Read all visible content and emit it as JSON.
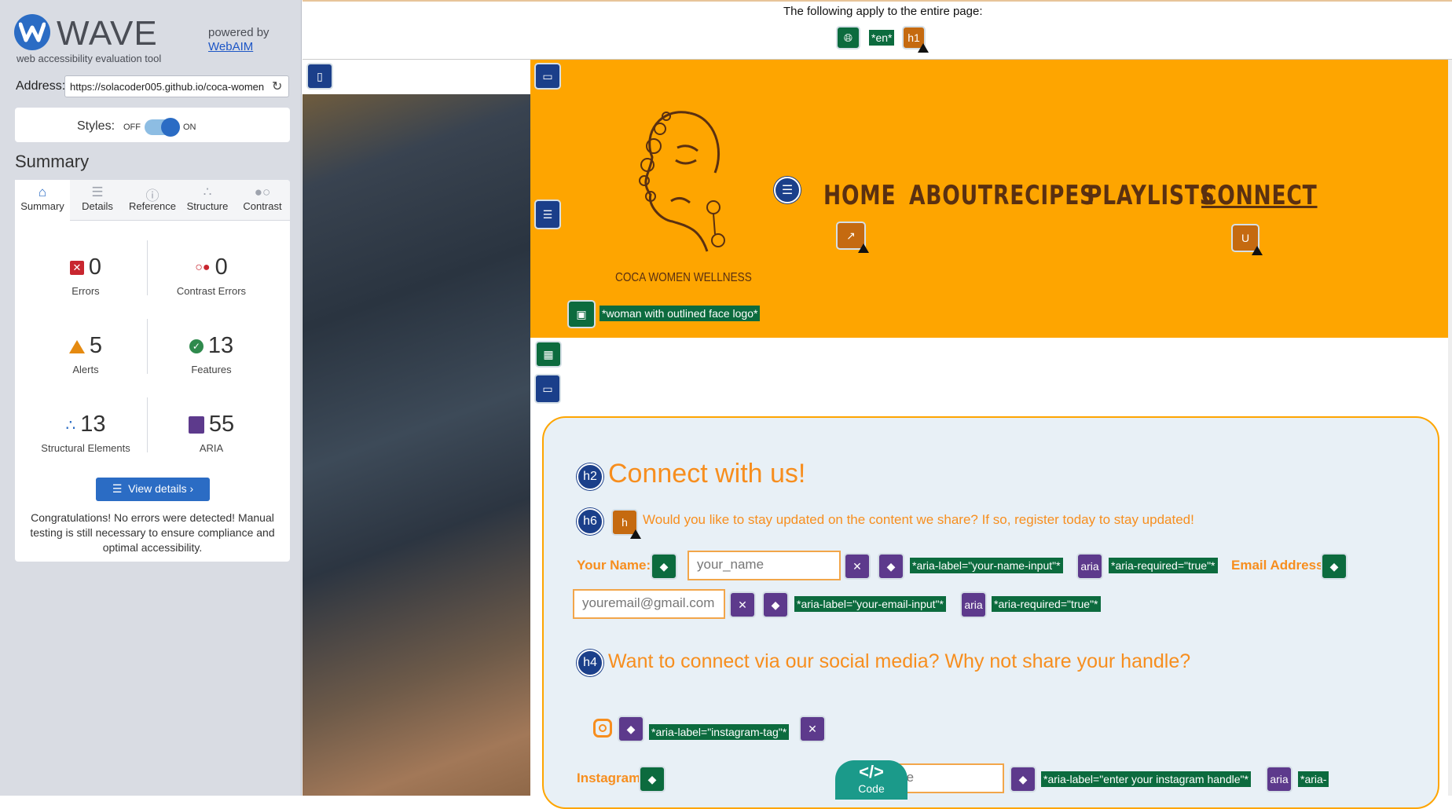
{
  "wave": {
    "logo_text": "WAVE",
    "logo_sub": "web accessibility evaluation tool",
    "powered_by": "powered by",
    "webaim": "WebAIM",
    "address_label": "Address:",
    "address_value": "https://solacoder005.github.io/coca-women",
    "styles_label": "Styles:",
    "styles_off": "OFF",
    "styles_on": "ON",
    "summary_heading": "Summary",
    "tabs": [
      {
        "label": "Summary",
        "icon": "home-icon"
      },
      {
        "label": "Details",
        "icon": "list-icon"
      },
      {
        "label": "Reference",
        "icon": "info-icon"
      },
      {
        "label": "Structure",
        "icon": "structure-icon"
      },
      {
        "label": "Contrast",
        "icon": "contrast-icon"
      }
    ],
    "stats": {
      "errors": {
        "count": "0",
        "label": "Errors"
      },
      "contrast_errors": {
        "count": "0",
        "label": "Contrast Errors"
      },
      "alerts": {
        "count": "5",
        "label": "Alerts"
      },
      "features": {
        "count": "13",
        "label": "Features"
      },
      "structural": {
        "count": "13",
        "label": "Structural Elements"
      },
      "aria": {
        "count": "55",
        "label": "ARIA"
      }
    },
    "view_details": "View details ›",
    "congrats": "Congratulations! No errors were detected! Manual testing is still necessary to ensure compliance and optimal accessibility."
  },
  "page": {
    "apply_text": "The following apply to the entire page:",
    "lang_tag": "*en*",
    "h1_badge": "h1",
    "logo_name": "COCA WOMEN WELLNESS",
    "logo_alt": "*woman with outlined face logo*",
    "nav": [
      "HOME",
      "ABOUT",
      "RECIPES",
      "PLAYLISTS",
      "CONNECT"
    ],
    "h2_badge": "h2",
    "heading": "Connect with us!",
    "h6_badge": "h6",
    "intro": "Would you like to stay updated on the content we share? If so, register today to stay updated!",
    "name_label": "Your Name:",
    "name_placeholder": "your_name",
    "name_aria_label": "*aria-label=\"your-name-input\"*",
    "aria_badge": "aria",
    "aria_required": "*aria-required=\"true\"*",
    "email_label": "Email Address:",
    "email_placeholder": "youremail@gmail.com",
    "email_aria_label": "*aria-label=\"your-email-input\"*",
    "h4_badge": "h4",
    "social_heading": "Want to connect via our social media? Why not share your handle?",
    "instagram_tag": "*aria-label=\"instagram-tag\"*",
    "instagram_label": "Instagram",
    "handle_placeholder": "handle",
    "handle_aria_label": "*aria-label=\"enter your instagram handle\"*",
    "aria_tail": "*aria-",
    "code_label": "Code",
    "code_glyph": "</>"
  },
  "colors": {
    "header_orange": "#fea500",
    "text_orange": "#f78e1e",
    "wave_blue": "#2b6cc4",
    "feature_green": "#0c6b3e",
    "aria_purple": "#5d3a8c",
    "alert_orange": "#c56a10"
  }
}
